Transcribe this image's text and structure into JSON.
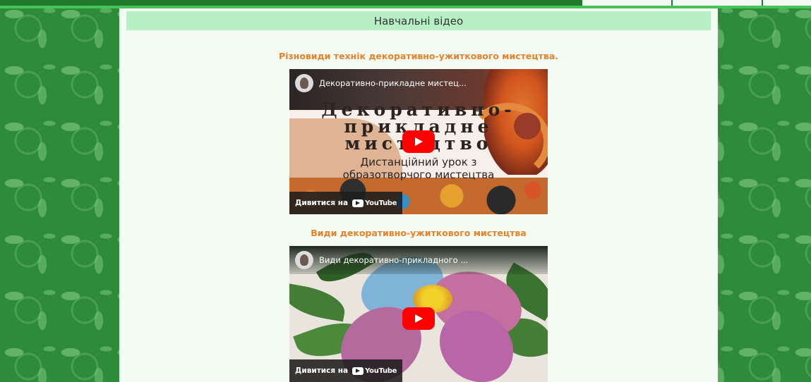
{
  "page": {
    "section_title": "Навчальні відео"
  },
  "videos": [
    {
      "heading": "Різновиди технік декоративно-ужиткового мистецтва.",
      "embed_title": "Декоративно-прикладне мистец...",
      "thumbnail_lines": [
        "Декоративно-",
        "прикладне",
        "мистецтво"
      ],
      "thumbnail_sub": [
        "Дистанційний урок з",
        "образотворчого мистецтва"
      ],
      "watch_label": "Дивитися на",
      "platform": "YouTube"
    },
    {
      "heading": "Види декоративно-ужиткового мистецтва",
      "embed_title": "Види декоративно-прикладного ...",
      "watch_label": "Дивитися на",
      "platform": "YouTube"
    }
  ],
  "colors": {
    "heading_orange": "#e8822a",
    "header_bg": "#b7f0c4",
    "youtube_red": "#ff0000",
    "page_green": "#2e8b3a"
  },
  "icons": {
    "play": "play-icon",
    "youtube": "youtube-logo-icon"
  }
}
